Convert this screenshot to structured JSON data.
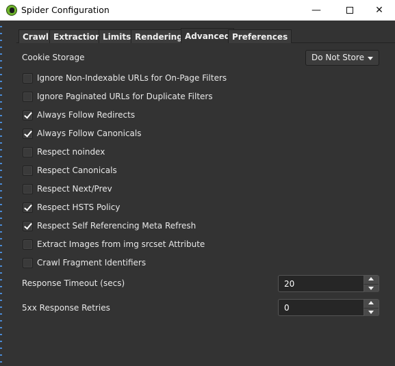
{
  "window": {
    "title": "Spider Configuration",
    "minimize_icon": "minimize-icon",
    "maximize_icon": "maximize-icon",
    "close_icon": "close-icon"
  },
  "tabs": [
    {
      "label": "Crawl"
    },
    {
      "label": "Extraction"
    },
    {
      "label": "Limits"
    },
    {
      "label": "Rendering"
    },
    {
      "label": "Advanced",
      "selected": true
    },
    {
      "label": "Preferences"
    }
  ],
  "cookie": {
    "label": "Cookie Storage",
    "value": "Do Not Store"
  },
  "options": [
    {
      "label": "Ignore Non-Indexable URLs for On-Page Filters",
      "checked": false
    },
    {
      "label": "Ignore Paginated URLs for Duplicate Filters",
      "checked": false
    },
    {
      "label": "Always Follow Redirects",
      "checked": true
    },
    {
      "label": "Always Follow Canonicals",
      "checked": true
    },
    {
      "label": "Respect noindex",
      "checked": false
    },
    {
      "label": "Respect Canonicals",
      "checked": false
    },
    {
      "label": "Respect Next/Prev",
      "checked": false
    },
    {
      "label": "Respect HSTS Policy",
      "checked": true
    },
    {
      "label": "Respect Self Referencing Meta Refresh",
      "checked": true
    },
    {
      "label": "Extract Images from img srcset Attribute",
      "checked": false
    },
    {
      "label": "Crawl Fragment Identifiers",
      "checked": false
    }
  ],
  "timeout": {
    "label": "Response Timeout (secs)",
    "value": "20"
  },
  "retries": {
    "label": "5xx Response Retries",
    "value": "0"
  }
}
